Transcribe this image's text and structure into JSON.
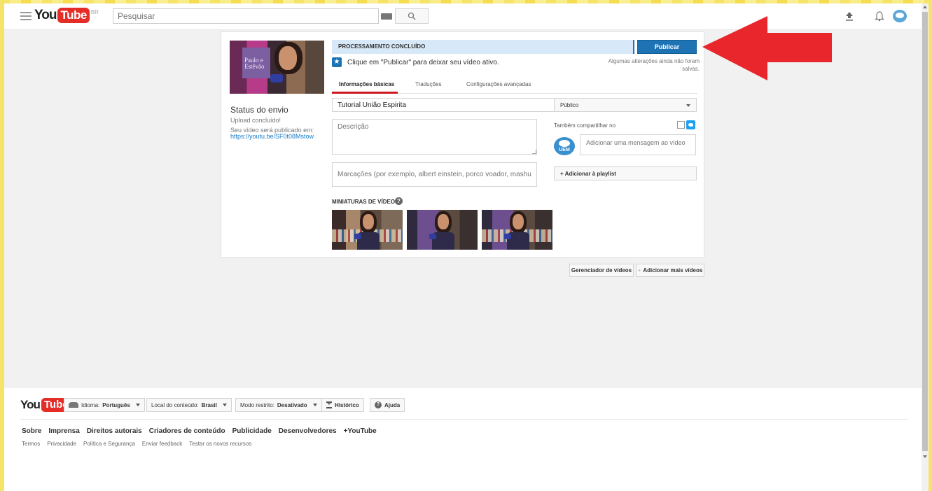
{
  "header": {
    "logo_you": "You",
    "logo_tube": "Tube",
    "logo_region": "BR",
    "search_placeholder": "Pesquisar"
  },
  "upload": {
    "status_title": "Status do envio",
    "status_line": "Upload concluído!",
    "publish_note": "Seu vídeo será publicado em:",
    "video_link": "https://youtu.be/SF0t08Mstow",
    "thumbnail_poster_text": "Paulo e Estêvão",
    "processing_text": "PROCESSAMENTO CONCLUÍDO",
    "publish_button": "Publicar",
    "hint_text": "Clique em \"Publicar\" para deixar seu vídeo ativo.",
    "changes_note": "Algumas alterações ainda não foram salvas.",
    "tabs": [
      {
        "label": "Informações básicas",
        "active": true
      },
      {
        "label": "Traduções",
        "active": false
      },
      {
        "label": "Configurações avançadas",
        "active": false
      }
    ],
    "title_value": "Tutorial União Espirita",
    "description_placeholder": "Descrição",
    "tags_placeholder": "Marcações (por exemplo, albert einstein, porco voador, mashup)",
    "visibility": "Público",
    "share_label": "Também compartilhar no",
    "share_message_placeholder": "Adicionar uma mensagem ao vídeo",
    "channel_logo_text": "UEM",
    "playlist_button": "+ Adicionar à playlist",
    "thumbnails_label": "MINIATURAS DE VÍDEOS",
    "thumbnail_count": 3
  },
  "actions": {
    "video_manager": "Gerenciador de vídeos",
    "add_more": "Adicionar mais vídeos"
  },
  "footer": {
    "logo_you": "You",
    "logo_tube": "Tube",
    "language_label": "Idioma:",
    "language_value": "Português",
    "location_label": "Local do conteúdo:",
    "location_value": "Brasil",
    "restricted_label": "Modo restrito:",
    "restricted_value": "Desativado",
    "history": "Histórico",
    "help": "Ajuda",
    "links_primary": [
      "Sobre",
      "Imprensa",
      "Direitos autorais",
      "Criadores de conteúdo",
      "Publicidade",
      "Desenvolvedores",
      "+YouTube"
    ],
    "links_secondary": [
      "Termos",
      "Privacidade",
      "Política e Segurança",
      "Enviar feedback",
      "Testar os novos recursos"
    ]
  },
  "colors": {
    "brand_red": "#e52d27",
    "publish_blue": "#1e73b5",
    "annotation_arrow": "#e8262c",
    "processing_bg": "#d7e9f8"
  },
  "icons": [
    "menu-icon",
    "keyboard-icon",
    "search-icon",
    "upload-icon",
    "bell-icon",
    "avatar",
    "star-icon",
    "twitter-icon",
    "help-icon",
    "language-icon",
    "hourglass-icon"
  ]
}
